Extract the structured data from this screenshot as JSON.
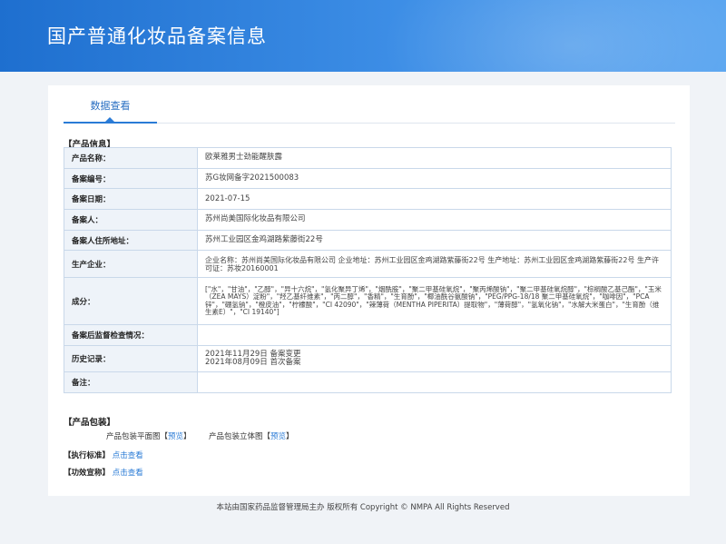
{
  "header": {
    "title": "国产普通化妆品备案信息"
  },
  "tabs": [
    {
      "label": "数据查看"
    }
  ],
  "product_info": {
    "section_title": "【产品信息】",
    "rows": [
      {
        "label": "产品名称：",
        "value": "欧莱雅男士劲能醒肤露"
      },
      {
        "label": "备案编号：",
        "value": "苏G妆网备字2021500083"
      },
      {
        "label": "备案日期：",
        "value": "2021-07-15"
      },
      {
        "label": "备案人：",
        "value": "苏州尚美国际化妆品有限公司"
      },
      {
        "label": "备案人住所地址：",
        "value": "苏州工业园区金鸡湖路紫藤街22号"
      },
      {
        "label": "生产企业：",
        "value": "企业名称：苏州尚美国际化妆品有限公司 企业地址：苏州工业园区金鸡湖路紫藤街22号 生产地址：苏州工业园区金鸡湖路紫藤街22号 生产许可证：苏妆20160001"
      },
      {
        "label": "成分：",
        "value": "[\"水\"，\"甘油\"，\"乙醇\"，\"异十六烷\"，\"氢化聚异丁烯\"，\"烟酰胺\"，\"聚二甲基硅氧烷\"，\"聚丙烯酸钠\"，\"聚二甲基硅氧烷醇\"，\"棕榈酸乙基己酯\"，\"玉米（ZEA MAYS）淀粉\"，\"羟乙基纤维素\"，\"丙二醇\"，\"香精\"，\"生育酚\"，\"椰油酰谷氨酸钠\"，\"PEG/PPG-18/18 聚二甲基硅氧烷\"，\"咖啡因\"，\"PCA 锌\"，\"硼氢钠\"，\"橙皮油\"，\"柠檬酸\"，\"CI 42090\"，\"辣薄荷（MENTHA PIPERITA）提取物\"，\"薄荷醇\"，\"氢氧化钠\"，\"水解大米蛋白\"，\"生育酚（维生素E）\"，\"CI 19140\"]"
      },
      {
        "label": "备案后监督检查情况：",
        "value": ""
      },
      {
        "label": "历史记录：",
        "value_lines": [
          "2021年11月29日 备案变更",
          "2021年08月09日 首次备案"
        ]
      },
      {
        "label": "备注：",
        "value": ""
      }
    ]
  },
  "packaging": {
    "section_title": "【产品包装】",
    "flat_label": "产品包装平面图",
    "flat_link": "预览",
    "stereo_label": "产品包装立体图",
    "stereo_link": "预览",
    "bracket_open": "【",
    "bracket_close": "】"
  },
  "standard": {
    "section_title": "【执行标准】",
    "link": "点击查看"
  },
  "efficacy": {
    "section_title": "【功效宣称】",
    "link": "点击查看"
  },
  "footer": {
    "text": "本站由国家药品监督管理局主办 版权所有 Copyright © NMPA All Rights Reserved"
  },
  "colors": {
    "header_start": "#1e6fcf",
    "header_end": "#5aa5f0",
    "accent": "#2a7bd6",
    "label_bg": "#eef3f9"
  }
}
